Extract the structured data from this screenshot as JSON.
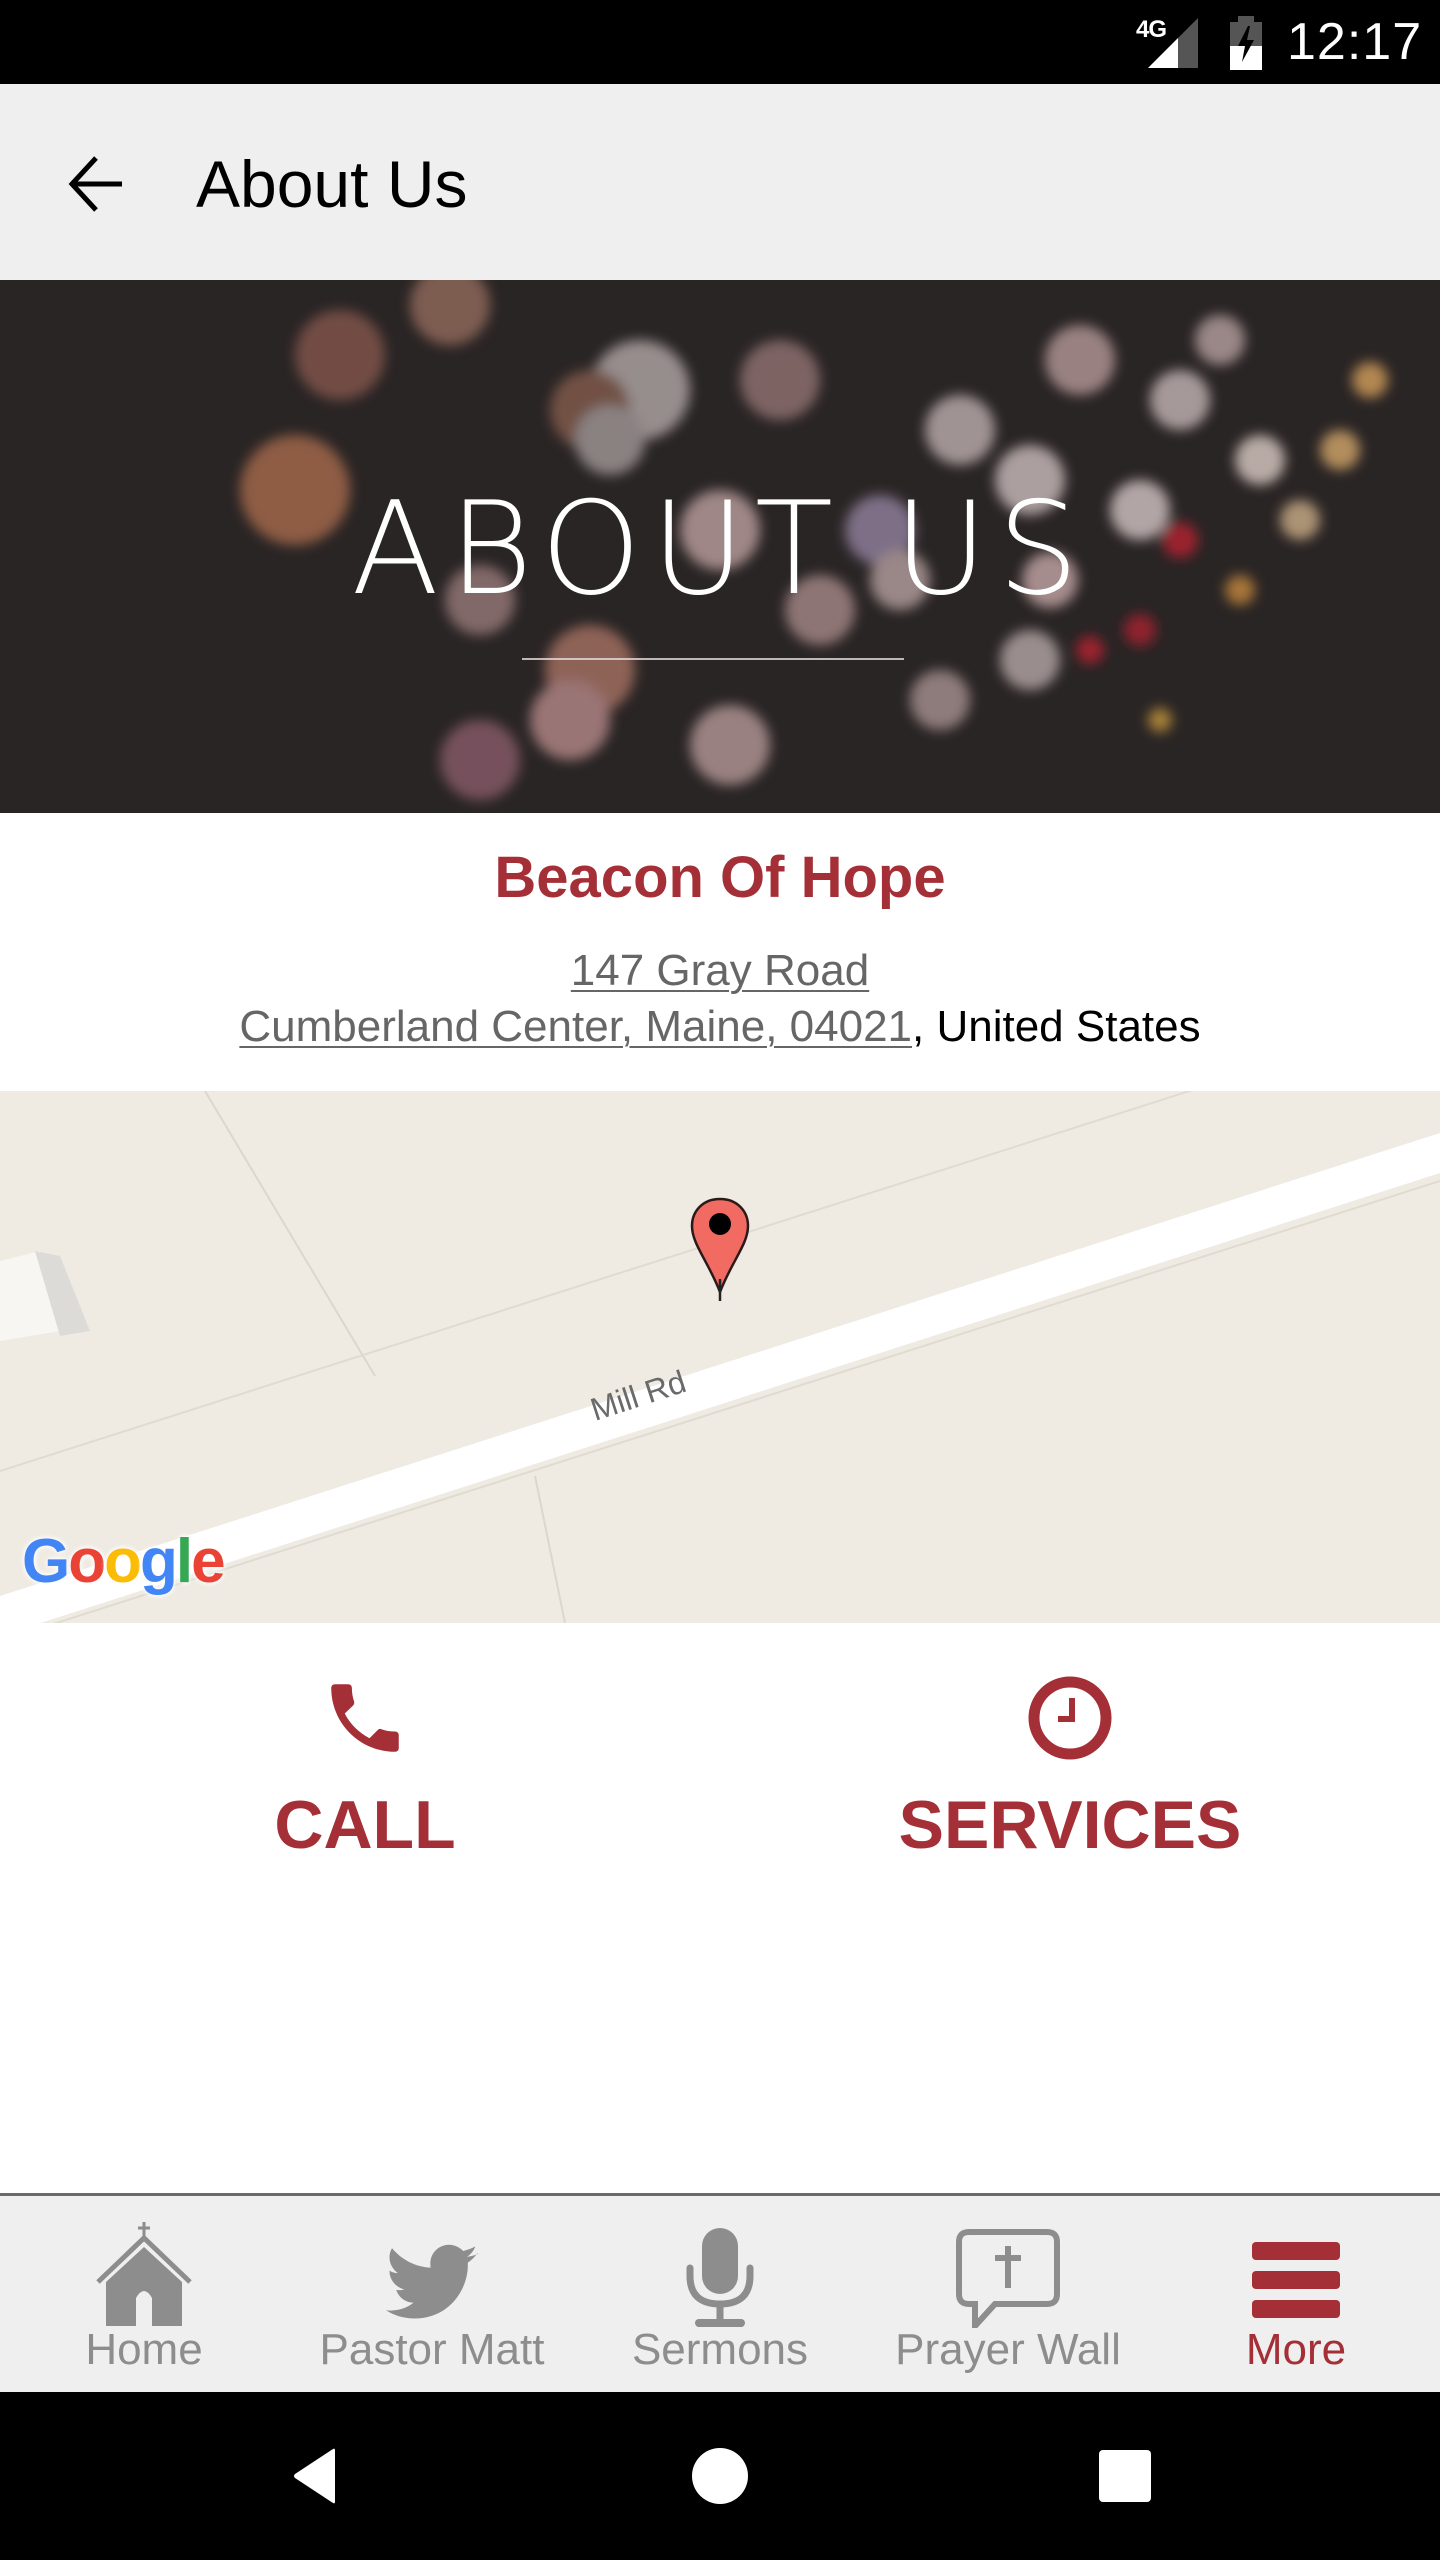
{
  "status_bar": {
    "network": "4G",
    "time": "12:17",
    "icons": [
      "signal-icon",
      "battery-charging-icon"
    ]
  },
  "app_bar": {
    "back_icon": "arrow-back-icon",
    "title": "About Us"
  },
  "hero": {
    "title": "ABOUT US"
  },
  "church": {
    "name": "Beacon Of Hope",
    "address_line1": "147 Gray Road",
    "address_line2_link": "Cumberland Center, Maine, 04021",
    "address_line2_suffix": ", United States"
  },
  "map": {
    "road_label": "Mill Rd",
    "marker_icon": "map-pin-icon",
    "attribution": "Google",
    "colors": {
      "land": "#efebe3",
      "road": "#ffffff",
      "marker": "#f26b63"
    }
  },
  "actions": [
    {
      "label": "CALL",
      "icon": "phone-icon"
    },
    {
      "label": "SERVICES",
      "icon": "clock-icon"
    }
  ],
  "tab_bar": {
    "items": [
      {
        "label": "Home",
        "icon": "church-icon",
        "active": false
      },
      {
        "label": "Pastor Matt",
        "icon": "twitter-bird-icon",
        "active": false
      },
      {
        "label": "Sermons",
        "icon": "microphone-icon",
        "active": false
      },
      {
        "label": "Prayer Wall",
        "icon": "prayer-bubble-icon",
        "active": false
      },
      {
        "label": "More",
        "icon": "menu-icon",
        "active": true
      }
    ]
  },
  "nav_bar": {
    "buttons": [
      "back-triangle-icon",
      "home-circle-icon",
      "recents-square-icon"
    ]
  },
  "colors": {
    "accent": "#a52f37",
    "inactive": "#8d8d8d",
    "app_bar_bg": "#efefef"
  }
}
